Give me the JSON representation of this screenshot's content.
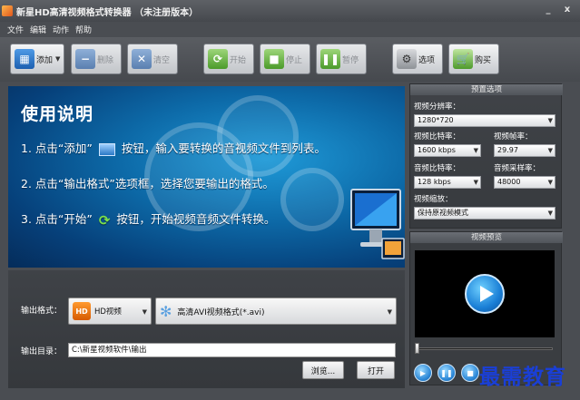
{
  "window": {
    "title": "新星HD高清视频格式转换器 （未注册版本）",
    "minimize_glyph": "_",
    "close_glyph": "x"
  },
  "menu": [
    "文件",
    "编辑",
    "动作",
    "帮助"
  ],
  "toolbar": {
    "add": "添加",
    "delete": "删除",
    "clear": "清空",
    "start": "开始",
    "stop": "停止",
    "pause": "暂停",
    "options": "选项",
    "buy": "购买"
  },
  "banner": {
    "title": "使用说明",
    "step1_a": "1. 点击“添加”",
    "step1_b": "按钮，输入要转换的音视频文件到列表。",
    "step2": "2. 点击“输出格式”选项框，选择您要输出的格式。",
    "step3_a": "3. 点击“开始”",
    "step3_b": "按钮，开始视频音频文件转换。"
  },
  "output": {
    "format_label": "输出格式：",
    "category_value": "HD视频",
    "category_badge": "HD",
    "format_value": "高清AVI视频格式(*.avi)",
    "dir_label": "输出目录：",
    "dir_value": "C:\\新星视频软件\\输出",
    "browse": "浏览...",
    "open": "打开"
  },
  "presets": {
    "heading": "预置选项",
    "resolution_label": "视频分辨率：",
    "resolution_value": "1280*720",
    "vbitrate_label": "视频比特率：",
    "vbitrate_value": "1600 kbps",
    "framerate_label": "视频帧率：",
    "framerate_value": "29.97",
    "abitrate_label": "音频比特率：",
    "abitrate_value": "128 kbps",
    "samplerate_label": "音频采样率：",
    "samplerate_value": "48000",
    "scale_label": "视频缩放：",
    "scale_value": "保持原视频模式"
  },
  "preview": {
    "heading": "视频预览"
  },
  "watermark": "最需教育",
  "colors": {
    "app_bg": "#4a4d52",
    "banner_blue": "#0d6aa8",
    "watermark_blue": "#1a3fd6",
    "hd_orange": "#e8741a"
  }
}
